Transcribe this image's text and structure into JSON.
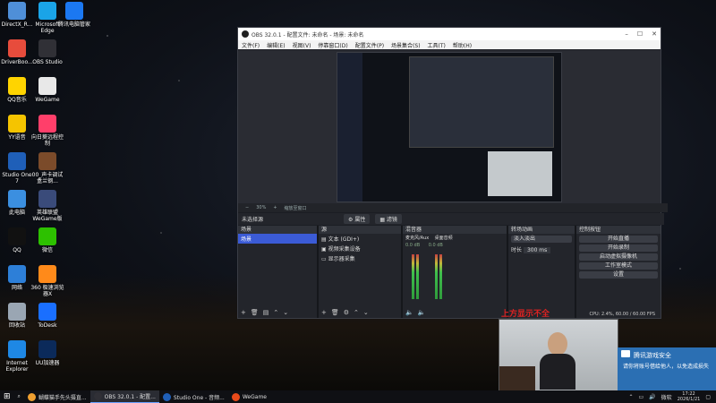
{
  "desktop": {
    "icons": [
      {
        "label": "DirectX_R...",
        "color": "#4f8fd8"
      },
      {
        "label": "Microsoft Edge",
        "color": "#1aa4e8"
      },
      {
        "label": "腾讯电脑管家",
        "color": "#1b78f2"
      },
      {
        "label": "DriverBoo...",
        "color": "#e74c3c"
      },
      {
        "label": "OBS Studio",
        "color": "#303036"
      },
      {
        "label": "QQ音乐",
        "color": "#ffd400"
      },
      {
        "label": "WeGame",
        "color": "#e8e8e8"
      },
      {
        "label": "YY语音",
        "color": "#f5c400"
      },
      {
        "label": "向日葵远程控制",
        "color": "#ff3f6a"
      },
      {
        "label": "Studio One 7",
        "color": "#1f5fb8"
      },
      {
        "label": "00_声卡调试盒兰钢...",
        "color": "#7b4b2a"
      },
      {
        "label": "此电脑",
        "color": "#3b8fe0"
      },
      {
        "label": "英雄联盟WeGame版",
        "color": "#3a4b7a"
      },
      {
        "label": "QQ",
        "color": "#111"
      },
      {
        "label": "微信",
        "color": "#2dc100"
      },
      {
        "label": "网络",
        "color": "#2d7fd8"
      },
      {
        "label": "360 极速浏览器X",
        "color": "#ff8a1a"
      },
      {
        "label": "回收站",
        "color": "#9aa6b3"
      },
      {
        "label": "ToDesk",
        "color": "#1a6fff"
      },
      {
        "label": "Internet Explorer",
        "color": "#1e88e5"
      },
      {
        "label": "UU加速器",
        "color": "#0b2a5a"
      }
    ]
  },
  "obs": {
    "title": "OBS 32.0.1 - 配置文件: 未命名 - 场景: 未命名",
    "menu": [
      "文件(F)",
      "编辑(E)",
      "视图(V)",
      "停靠窗口(D)",
      "配置文件(P)",
      "场景集合(S)",
      "工具(T)",
      "帮助(H)"
    ],
    "zoom_label": "30%",
    "fit_label": "缩放至窗口",
    "source_bar_label": "未选择源",
    "scene_tabs": [
      "属性",
      "滤镜"
    ],
    "scenes": {
      "title": "场景",
      "items": [
        "场景"
      ]
    },
    "sources": {
      "title": "源",
      "items": [
        "文本 (GDI+)",
        "视频采集设备",
        "显示器采集"
      ]
    },
    "mixer": {
      "title": "混音器",
      "channels": [
        {
          "name": "麦克风/Aux",
          "db": "0.0 dB"
        },
        {
          "name": "桌面音频",
          "db": "0.0 dB"
        }
      ]
    },
    "transitions": {
      "title": "转场动画",
      "type": "淡入淡出",
      "duration_label": "时长",
      "duration": "300 ms"
    },
    "controls": {
      "title": "控制按钮",
      "buttons": [
        "开始直播",
        "开始录制",
        "启动虚拟摄像机",
        "工作室模式",
        "设置"
      ]
    },
    "status": "CPU: 2.4%, 60.00 / 60.00 FPS"
  },
  "overlay": {
    "red_text": "上方显示不全"
  },
  "toast": {
    "title": "腾讯游戏安全",
    "message": "请你将账号借给他人，以免造成损失"
  },
  "taskbar": {
    "tasks": [
      {
        "label": "蝴蝶猫手先头摄直...",
        "color": "#f0a030"
      },
      {
        "label": "OBS 32.0.1 - 配置...",
        "color": "#303036"
      },
      {
        "label": "Studio One - 音频...",
        "color": "#1f5fb8"
      },
      {
        "label": "WeGame",
        "color": "#e84a1a"
      }
    ],
    "ime": "微软",
    "time": "17:22",
    "date": "2026/1/21"
  }
}
